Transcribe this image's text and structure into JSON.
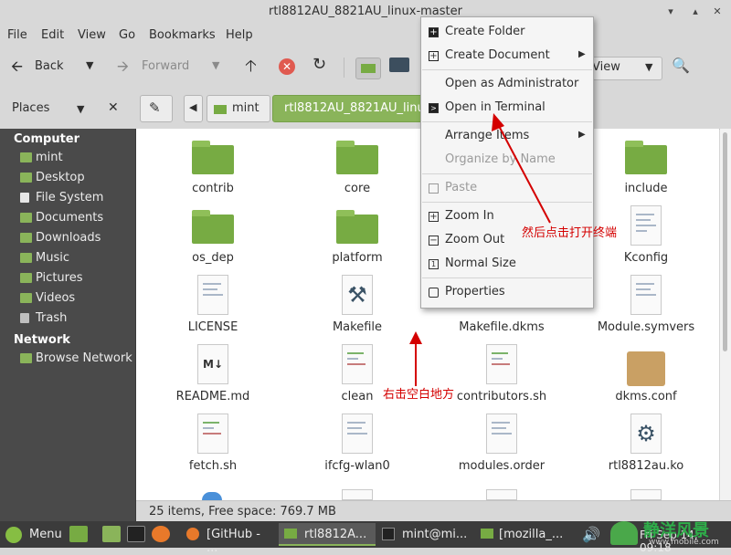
{
  "window": {
    "title": "rtl8812AU_8821AU_linux-master"
  },
  "menubar": {
    "file": "File",
    "edit": "Edit",
    "view": "View",
    "go": "Go",
    "bookmarks": "Bookmarks",
    "help": "Help"
  },
  "toolbar": {
    "back": "Back",
    "forward": "Forward",
    "view_mode": "View"
  },
  "places": {
    "title": "Places"
  },
  "path": {
    "mint": "mint",
    "current": "rtl8812AU_8821AU_linu"
  },
  "sidebar": {
    "computer_header": "Computer",
    "items": [
      "mint",
      "Desktop",
      "File System",
      "Documents",
      "Downloads",
      "Music",
      "Pictures",
      "Videos",
      "Trash"
    ],
    "network_header": "Network",
    "network_items": [
      "Browse Network"
    ]
  },
  "files": [
    {
      "name": "contrib",
      "type": "folder"
    },
    {
      "name": "core",
      "type": "folder"
    },
    {
      "name": "include",
      "type": "folder"
    },
    {
      "name": "os_dep",
      "type": "folder"
    },
    {
      "name": "platform",
      "type": "folder"
    },
    {
      "name": "Kconfig",
      "type": "text"
    },
    {
      "name": "LICENSE",
      "type": "text"
    },
    {
      "name": "Makefile",
      "type": "makefile"
    },
    {
      "name": "Makefile.dkms",
      "type": "text"
    },
    {
      "name": "Module.symvers",
      "type": "text"
    },
    {
      "name": "README.md",
      "type": "markdown"
    },
    {
      "name": "clean",
      "type": "script"
    },
    {
      "name": "contributors.sh",
      "type": "script"
    },
    {
      "name": "dkms.conf",
      "type": "package"
    },
    {
      "name": "fetch.sh",
      "type": "script"
    },
    {
      "name": "ifcfg-wlan0",
      "type": "text"
    },
    {
      "name": "modules.order",
      "type": "text"
    },
    {
      "name": "rtl8812au.ko",
      "type": "gear"
    }
  ],
  "status": {
    "text": "25 items, Free space: 769.7 MB"
  },
  "context_menu": {
    "items": [
      {
        "label": "Create Folder",
        "enabled": true
      },
      {
        "label": "Create Document",
        "enabled": true
      },
      {
        "label": "Open as Administrator",
        "enabled": true
      },
      {
        "label": "Open in Terminal",
        "enabled": true
      },
      {
        "label": "Arrange Items",
        "enabled": true
      },
      {
        "label": "Organize by Name",
        "enabled": false
      },
      {
        "label": "Paste",
        "enabled": false
      },
      {
        "label": "Zoom In",
        "enabled": true
      },
      {
        "label": "Zoom Out",
        "enabled": true
      },
      {
        "label": "Normal Size",
        "enabled": true
      },
      {
        "label": "Properties",
        "enabled": true
      }
    ]
  },
  "annotations": {
    "right_click": "右击空白地方",
    "then_click": "然后点击打开终端"
  },
  "taskbar": {
    "menu": "Menu",
    "windows": [
      "[GitHub - ...",
      "rtl8812A...",
      "mint@mi...",
      "[mozilla_..."
    ],
    "clock": "Fri Sep 14, 09:18",
    "watermark": "静洋风景",
    "watermark_url": "www.mobile.com"
  },
  "colors": {
    "folder": "#77ab43",
    "sidebar_bg": "#4a4a4a",
    "active_path": "#8ab45a",
    "annotation": "#d40000"
  }
}
